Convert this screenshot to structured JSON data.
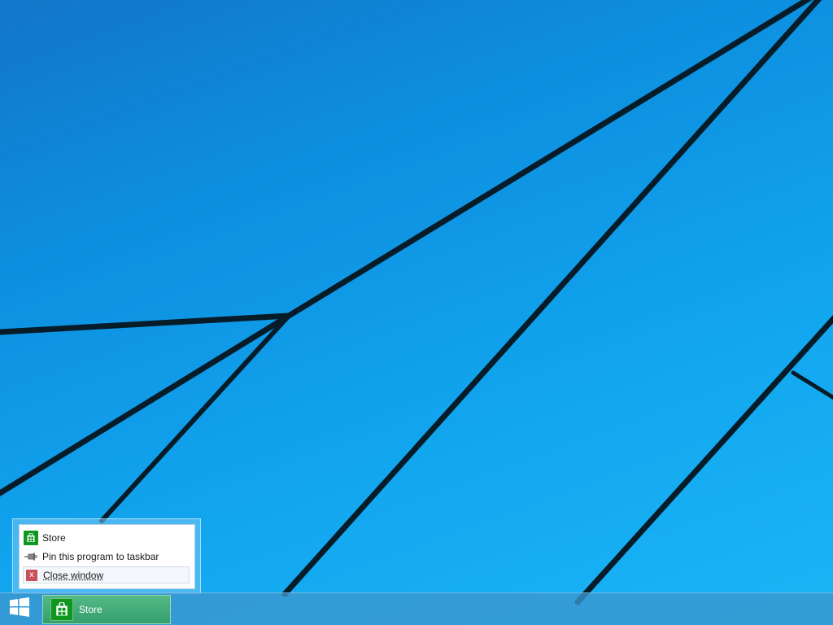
{
  "desktop": {
    "background_color": "#0d8fe0"
  },
  "jumplist": {
    "app_title": "Store",
    "app_icon": "store-bag-icon",
    "pin_label": "Pin this program to taskbar",
    "pin_icon": "pin-icon",
    "close_label": "Close window",
    "close_icon": "close-icon",
    "close_icon_glyph": "x"
  },
  "taskbar": {
    "start_icon": "windows-logo-icon",
    "apps": [
      {
        "label": "Store",
        "icon": "store-bag-icon",
        "accent": "#11971f",
        "active": true
      }
    ]
  }
}
